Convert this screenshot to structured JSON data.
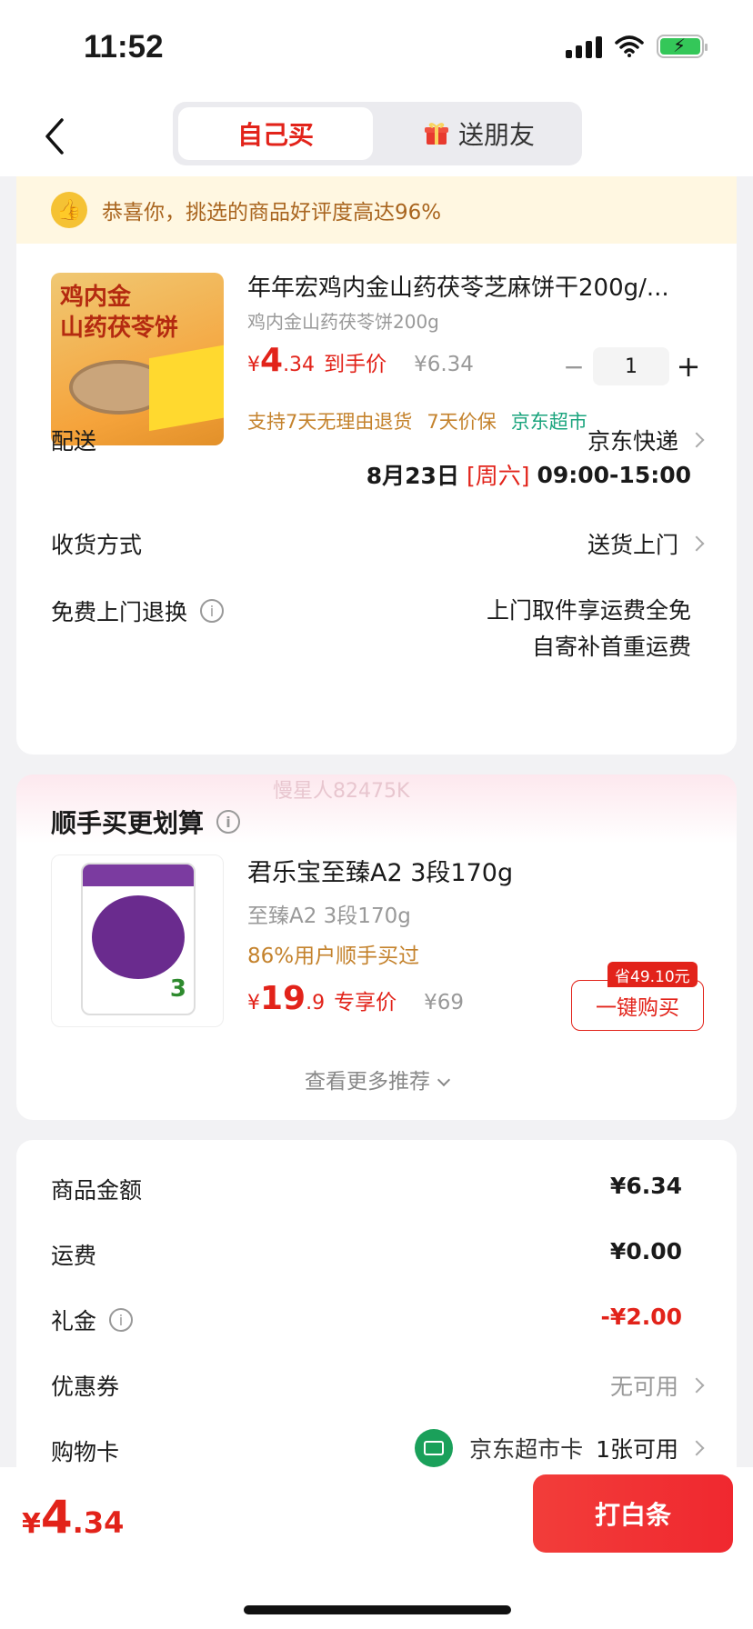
{
  "status": {
    "time": "11:52"
  },
  "header": {
    "tab_self": "自己买",
    "tab_friend": "送朋友"
  },
  "notice": {
    "text": "恭喜你，挑选的商品好评度高达96%"
  },
  "product": {
    "image_text_line1": "鸡内金",
    "image_text_line2": "山药茯苓饼",
    "title": "年年宏鸡内金山药茯苓芝麻饼干200g/...",
    "subtitle": "鸡内金山药茯苓饼200g",
    "price_currency": "¥",
    "price_int": "4",
    "price_dec": ".34",
    "price_tag": "到手价",
    "original_price": "¥6.34",
    "quantity": "1",
    "minus": "−",
    "plus": "+",
    "service_1": "支持7天无理由退货",
    "service_2": "7天价保",
    "service_3": "京东超市"
  },
  "delivery": {
    "label": "配送",
    "method": "京东快递",
    "date": "8月23日",
    "weekday": "[周六]",
    "time": "09:00-15:00",
    "receive_label": "收货方式",
    "receive_value": "送货上门",
    "return_label": "免费上门退换",
    "return_line1": "上门取件享运费全免",
    "return_line2": "自寄补首重运费"
  },
  "recommend": {
    "watermark": "慢星人82475K",
    "title": "顺手买更划算",
    "item_title": "君乐宝至臻A2 3段170g",
    "item_sub": "至臻A2 3段170g",
    "item_pct": "86%用户顺手买过",
    "price_currency": "¥",
    "price_int": "19",
    "price_dec": ".9",
    "price_tag": "专享价",
    "original_price": "¥69",
    "save_tag": "省49.10元",
    "buy_label": "一键购买",
    "more_label": "查看更多推荐"
  },
  "summary": {
    "goods_label": "商品金额",
    "goods_value": "¥6.34",
    "shipping_label": "运费",
    "shipping_value": "¥0.00",
    "gift_label": "礼金",
    "gift_value": "-¥2.00",
    "coupon_label": "优惠券",
    "coupon_value": "无可用",
    "card_label": "购物卡",
    "card_name": "京东超市卡",
    "card_value": "1张可用"
  },
  "footer": {
    "total_currency": "¥",
    "total_int": "4",
    "total_dec": ".34",
    "pay_label": "打白条"
  },
  "colors": {
    "accent": "#e2231a",
    "green": "#1aa47d",
    "orange": "#c4822c"
  }
}
